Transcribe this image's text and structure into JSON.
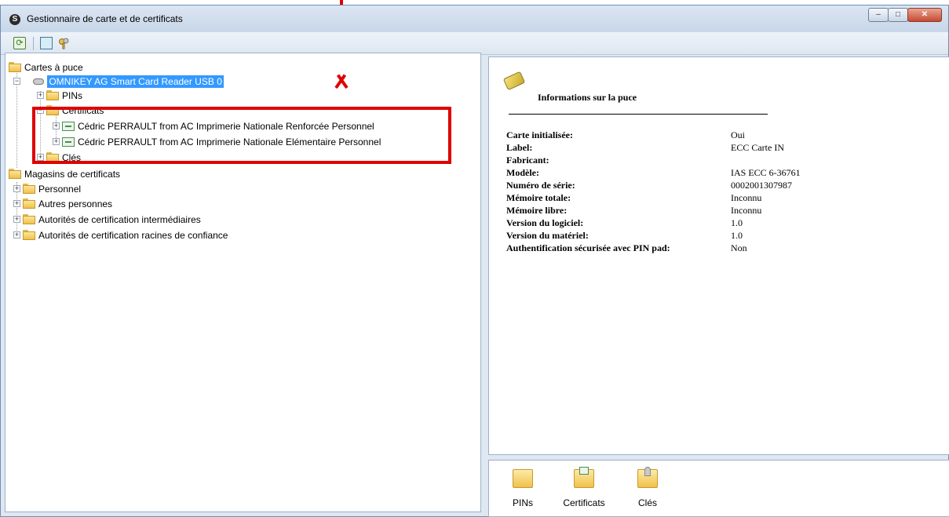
{
  "window": {
    "title": "Gestionnaire de carte et de certificats"
  },
  "tree": {
    "smartcards": {
      "label": "Cartes à puce",
      "reader": "OMNIKEY AG Smart Card Reader USB 0",
      "pins": "PINs",
      "certificates": "Certificats",
      "cert1": "Cédric PERRAULT from AC Imprimerie Nationale Renforcée Personnel",
      "cert2": "Cédric PERRAULT from AC Imprimerie Nationale Elémentaire Personnel",
      "keys": "Clés"
    },
    "stores": {
      "label": "Magasins de certificats",
      "items": [
        "Personnel",
        "Autres personnes",
        "Autorités de certification intermédiaires",
        "Autorités de certification racines de confiance"
      ]
    }
  },
  "info": {
    "title": "Informations sur la puce",
    "rows": [
      {
        "key": "Carte initialisée:",
        "value": "Oui"
      },
      {
        "key": "Label:",
        "value": "ECC Carte IN"
      },
      {
        "key": "Fabricant:",
        "value": ""
      },
      {
        "key": "Modèle:",
        "value": "IAS ECC 6-36761"
      },
      {
        "key": "Numéro de série:",
        "value": "0002001307987"
      },
      {
        "key": "Mémoire totale:",
        "value": "Inconnu"
      },
      {
        "key": "Mémoire libre:",
        "value": "Inconnu"
      },
      {
        "key": "Version du logiciel:",
        "value": "1.0"
      },
      {
        "key": "Version du matériel:",
        "value": "1.0"
      },
      {
        "key": "Authentification sécurisée avec PIN pad:",
        "value": "Non"
      }
    ]
  },
  "bottom": {
    "items": [
      "PINs",
      "Certificats",
      "Clés"
    ]
  },
  "colors": {
    "highlight": "#e00000",
    "selection": "#3399ff"
  }
}
